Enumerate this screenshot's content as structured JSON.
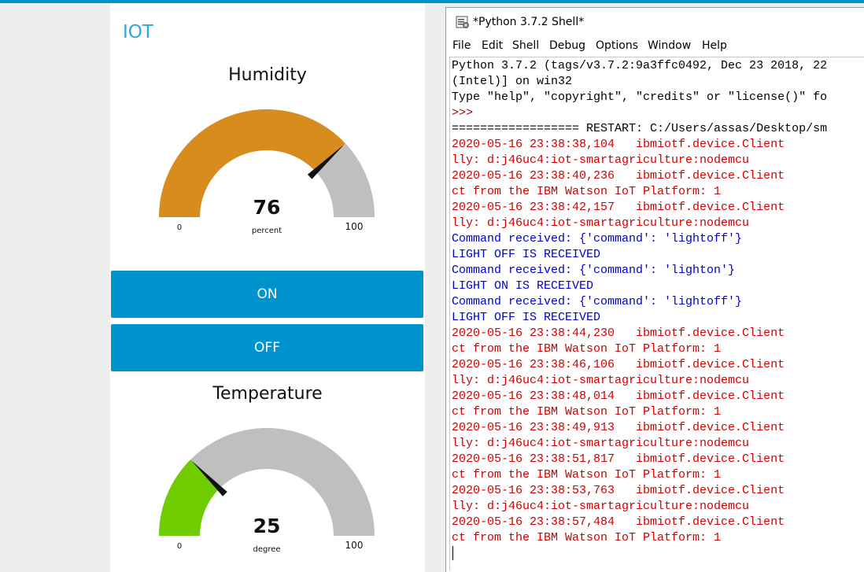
{
  "dashboard": {
    "title": "IOT",
    "humidity": {
      "title": "Humidity",
      "value": "76",
      "unit": "percent",
      "min": "0",
      "max": "100",
      "level": 76,
      "color": "#d98c1e"
    },
    "temperature": {
      "title": "Temperature",
      "value": "25",
      "unit": "degree",
      "min": "0",
      "max": "100",
      "level": 25,
      "color": "#6fcc00"
    },
    "buttons": {
      "on_label": "ON",
      "off_label": "OFF"
    },
    "colors": {
      "accent": "#0094ce",
      "gauge_track": "#bfbfbf",
      "title": "#31a7d8"
    }
  },
  "shell": {
    "window_title": "*Python 3.7.2 Shell*",
    "menu": [
      "File",
      "Edit",
      "Shell",
      "Debug",
      "Options",
      "Window",
      "Help"
    ],
    "lines": [
      {
        "text": "Python 3.7.2 (tags/v3.7.2:9a3ffc0492, Dec 23 2018, 22",
        "style": "normal"
      },
      {
        "text": "(Intel)] on win32",
        "style": "normal"
      },
      {
        "text": "Type \"help\", \"copyright\", \"credits\" or \"license()\" fo",
        "style": "normal"
      },
      {
        "text": ">>> ",
        "style": "prompt"
      },
      {
        "text": "================== RESTART: C:/Users/assas/Desktop/sm",
        "style": "normal"
      },
      {
        "text": "2020-05-16 23:38:38,104   ibmiotf.device.Client",
        "style": "error"
      },
      {
        "text": "lly: d:j46uc4:iot-smartagriculture:nodemcu",
        "style": "error"
      },
      {
        "text": "2020-05-16 23:38:40,236   ibmiotf.device.Client",
        "style": "error"
      },
      {
        "text": "ct from the IBM Watson IoT Platform: 1",
        "style": "error"
      },
      {
        "text": "2020-05-16 23:38:42,157   ibmiotf.device.Client",
        "style": "error"
      },
      {
        "text": "lly: d:j46uc4:iot-smartagriculture:nodemcu",
        "style": "error"
      },
      {
        "text": "Command received: {'command': 'lightoff'}",
        "style": "output"
      },
      {
        "text": "LIGHT OFF IS RECEIVED",
        "style": "output"
      },
      {
        "text": "Command received: {'command': 'lighton'}",
        "style": "output"
      },
      {
        "text": "LIGHT ON IS RECEIVED",
        "style": "output"
      },
      {
        "text": "Command received: {'command': 'lightoff'}",
        "style": "output"
      },
      {
        "text": "LIGHT OFF IS RECEIVED",
        "style": "output"
      },
      {
        "text": "2020-05-16 23:38:44,230   ibmiotf.device.Client",
        "style": "error"
      },
      {
        "text": "ct from the IBM Watson IoT Platform: 1",
        "style": "error"
      },
      {
        "text": "2020-05-16 23:38:46,106   ibmiotf.device.Client",
        "style": "error"
      },
      {
        "text": "lly: d:j46uc4:iot-smartagriculture:nodemcu",
        "style": "error"
      },
      {
        "text": "2020-05-16 23:38:48,014   ibmiotf.device.Client",
        "style": "error"
      },
      {
        "text": "ct from the IBM Watson IoT Platform: 1",
        "style": "error"
      },
      {
        "text": "2020-05-16 23:38:49,913   ibmiotf.device.Client",
        "style": "error"
      },
      {
        "text": "lly: d:j46uc4:iot-smartagriculture:nodemcu",
        "style": "error"
      },
      {
        "text": "2020-05-16 23:38:51,817   ibmiotf.device.Client",
        "style": "error"
      },
      {
        "text": "ct from the IBM Watson IoT Platform: 1",
        "style": "error"
      },
      {
        "text": "2020-05-16 23:38:53,763   ibmiotf.device.Client",
        "style": "error"
      },
      {
        "text": "lly: d:j46uc4:iot-smartagriculture:nodemcu",
        "style": "error"
      },
      {
        "text": "2020-05-16 23:38:57,484   ibmiotf.device.Client",
        "style": "error"
      },
      {
        "text": "ct from the IBM Watson IoT Platform: 1",
        "style": "error"
      }
    ]
  }
}
